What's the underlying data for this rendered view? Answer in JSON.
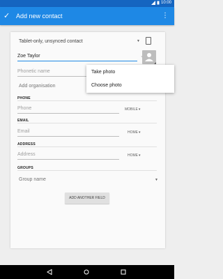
{
  "status_bar": {
    "time": "10:00"
  },
  "app_bar": {
    "title": "Add new contact",
    "menu_icon": "more-vert-icon"
  },
  "form": {
    "account": "Tablet-only, unsynced contact",
    "name_value": "Zoe Taylor",
    "phonetic_placeholder": "Phonetic name",
    "organisation_placeholder": "Add organisation",
    "phone": {
      "header": "PHONE",
      "placeholder": "Phone",
      "type": "MOBILE"
    },
    "email": {
      "header": "EMAIL",
      "placeholder": "Email",
      "type": "HOME"
    },
    "address": {
      "header": "ADDRESS",
      "placeholder": "Address",
      "type": "HOME"
    },
    "groups": {
      "header": "GROUPS",
      "placeholder": "Group name"
    },
    "add_field_label": "ADD ANOTHER FIELD"
  },
  "photo_menu": {
    "items": [
      "Take photo",
      "Choose photo"
    ]
  },
  "colors": {
    "app_bar": "#1e88e5",
    "status_bar": "#1565c0",
    "accent": "#1e88e5"
  }
}
